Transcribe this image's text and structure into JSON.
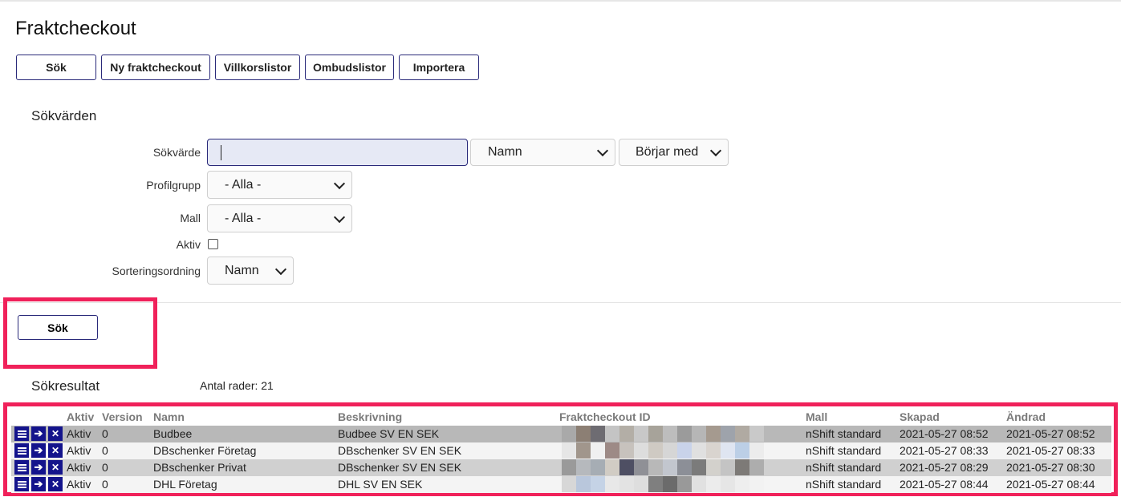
{
  "page": {
    "title": "Fraktcheckout"
  },
  "toolbar": [
    {
      "label": "Sök",
      "name": "toolbar-sok-button"
    },
    {
      "label": "Ny fraktcheckout",
      "name": "ny-fraktcheckout-button"
    },
    {
      "label": "Villkorslistor",
      "name": "villkorslistor-button"
    },
    {
      "label": "Ombudslistor",
      "name": "ombudslistor-button"
    },
    {
      "label": "Importera",
      "name": "importera-button"
    }
  ],
  "search": {
    "section_title": "Sökvärden",
    "sokvarde_label": "Sökvärde",
    "sokvarde_value": "",
    "field_select": "Namn",
    "match_select": "Börjar med",
    "profilgrupp_label": "Profilgrupp",
    "profilgrupp_value": "- Alla -",
    "mall_label": "Mall",
    "mall_value": "- Alla -",
    "aktiv_label": "Aktiv",
    "aktiv_checked": false,
    "sort_label": "Sorteringsordning",
    "sort_value": "Namn",
    "submit_label": "Sök"
  },
  "results": {
    "section_title": "Sökresultat",
    "count_text": "Antal rader: 21",
    "columns": [
      "Aktiv",
      "Version",
      "Namn",
      "Beskrivning",
      "Fraktcheckout ID",
      "Mall",
      "Skapad",
      "Ändrad"
    ],
    "rows": [
      {
        "aktiv": "Aktiv",
        "version": "0",
        "namn": "Budbee",
        "beskrivning": "Budbee SV EN SEK",
        "mall": "nShift standard",
        "skapad": "2021-05-27 08:52",
        "andrad": "2021-05-27 08:52"
      },
      {
        "aktiv": "Aktiv",
        "version": "0",
        "namn": "DBschenker Företag",
        "beskrivning": "DBschenker SV EN SEK",
        "mall": "nShift standard",
        "skapad": "2021-05-27 08:33",
        "andrad": "2021-05-27 08:33"
      },
      {
        "aktiv": "Aktiv",
        "version": "0",
        "namn": "DBschenker Privat",
        "beskrivning": "DBschenker SV EN SEK",
        "mall": "nShift standard",
        "skapad": "2021-05-27 08:29",
        "andrad": "2021-05-27 08:30"
      },
      {
        "aktiv": "Aktiv",
        "version": "0",
        "namn": "DHL Företag",
        "beskrivning": "DHL SV EN SEK",
        "mall": "nShift standard",
        "skapad": "2021-05-27 08:44",
        "andrad": "2021-05-27 08:44"
      }
    ]
  },
  "colors": {
    "accent": "#14148c",
    "highlight": "#f0215a",
    "input_bg": "#e6e9f5"
  },
  "icons": [
    "list-icon",
    "arrow-right-icon",
    "close-icon",
    "chevron-down-icon"
  ]
}
